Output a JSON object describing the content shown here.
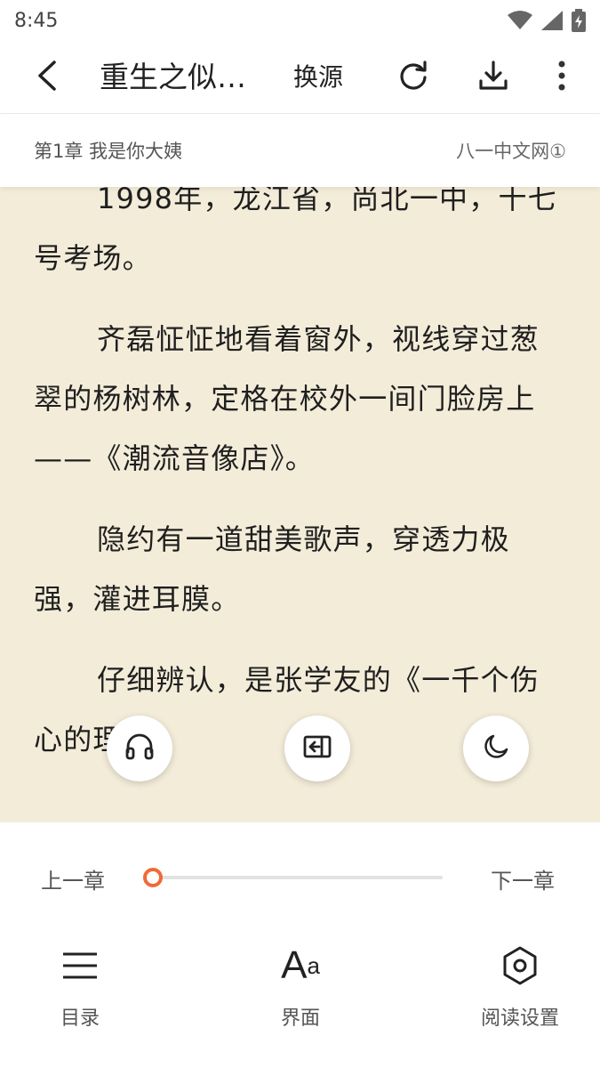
{
  "status_bar": {
    "time": "8:45",
    "icons": [
      "wifi-icon",
      "signal-icon",
      "battery-charging-icon"
    ]
  },
  "toolbar": {
    "back_icon": "arrow-back-icon",
    "title": "重生之似…",
    "change_source_label": "换源",
    "refresh_icon": "refresh-icon",
    "download_icon": "download-icon",
    "more_icon": "more-vert-icon"
  },
  "chapter": {
    "title": "第1章 我是你大姨",
    "source": "八一中文网①"
  },
  "reader": {
    "background": "#f3ecd9",
    "paragraphs": [
      "1998年，龙江省，尚北一中，十七号考场。",
      "齐磊怔怔地看着窗外，视线穿过葱翠的杨树林，定格在校外一间门脸房上——《潮流音像店》。",
      "隐约有一道甜美歌声，穿透力极强，灌进耳膜。",
      "仔细辨认，是张学友的《一千个伤心的理由》"
    ]
  },
  "floating_buttons": {
    "audio_icon": "headphones-icon",
    "exit_icon": "exit-reading-icon",
    "night_icon": "moon-icon"
  },
  "chapter_nav": {
    "prev_label": "上一章",
    "next_label": "下一章",
    "progress": 0.0,
    "accent_color": "#f06a35"
  },
  "bottom_menu": {
    "items": [
      {
        "label": "目录",
        "icon": "menu-list-icon"
      },
      {
        "label": "界面",
        "icon": "font-size-icon",
        "glyph_big": "A",
        "glyph_small": "a"
      },
      {
        "label": "阅读设置",
        "icon": "settings-hexagon-icon"
      }
    ]
  }
}
